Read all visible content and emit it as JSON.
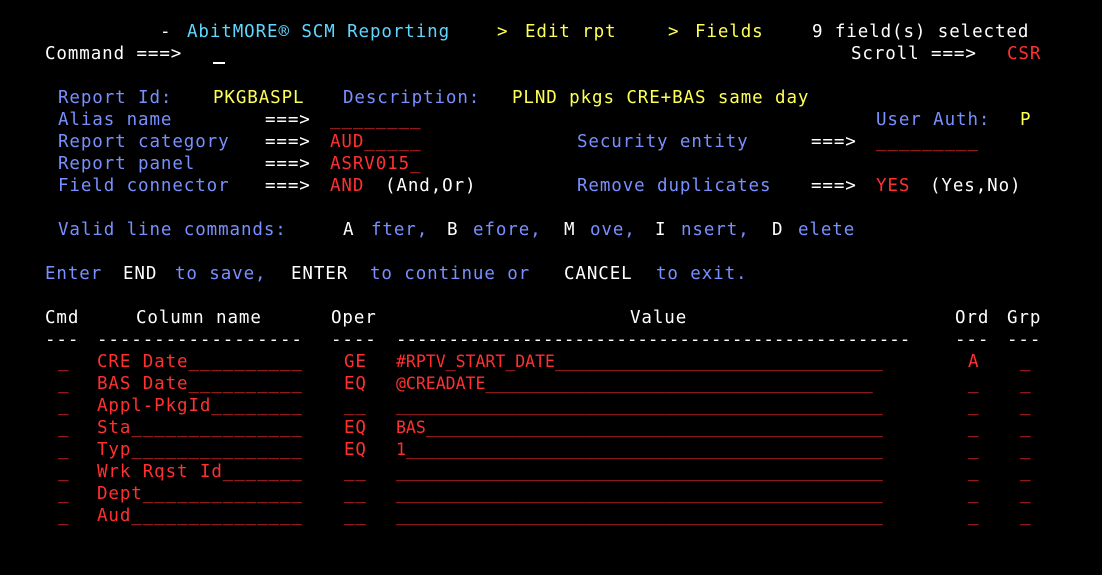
{
  "header": {
    "dash": "-",
    "product": "AbitMORE® SCM Reporting",
    "sep1": ">",
    "crumb1": "Edit rpt",
    "sep2": ">",
    "crumb2": "Fields",
    "status": "9 field(s) selected"
  },
  "command": {
    "label": "Command ===>",
    "value": "",
    "scroll_label": "Scroll ===>",
    "scroll_value": "CSR"
  },
  "report": {
    "id_label": "Report Id:",
    "id_value": "PKGBASPL",
    "desc_label": "Description:",
    "desc_value": "PLND pkgs CRE+BAS same day",
    "alias_label": "Alias name",
    "alias_arrow": "===>",
    "alias_value": "________",
    "user_auth_label": "User Auth:",
    "user_auth_value": "P",
    "category_label": "Report category",
    "category_arrow": "===>",
    "category_value": "AUD_____",
    "security_label": "Security entity",
    "security_arrow": "===>",
    "security_value": "_________",
    "panel_label": "Report panel",
    "panel_arrow": "===>",
    "panel_value": "ASRV015_",
    "connector_label": "Field connector",
    "connector_arrow": "===>",
    "connector_value": "AND",
    "connector_hint": "(And,Or)",
    "remove_dup_label": "Remove duplicates",
    "remove_dup_arrow": "===>",
    "remove_dup_value": "YES",
    "remove_dup_hint": "(Yes,No)"
  },
  "line_commands": {
    "label": "Valid line commands:",
    "a_key": "A",
    "a_text": "fter,",
    "b_key": "B",
    "b_text": "efore,",
    "m_key": "M",
    "m_text": "ove,",
    "i_key": "I",
    "i_text": "nsert,",
    "d_key": "D",
    "d_text": "elete"
  },
  "instructions": {
    "t1": "Enter",
    "k1": "END",
    "t2": "to save,",
    "k2": "ENTER",
    "t3": "to continue or",
    "k3": "CANCEL",
    "t4": "to exit."
  },
  "table": {
    "headers": {
      "cmd": "Cmd",
      "column": "Column name",
      "oper": "Oper",
      "value": "Value",
      "ord": "Ord",
      "grp": "Grp"
    },
    "dividers": {
      "cmd": "---",
      "column": "------------------",
      "oper": "----",
      "value": "-------------------------------------------------",
      "ord": "---",
      "grp": "---"
    },
    "rows": [
      {
        "cmd": "_",
        "column": "CRE Date__________",
        "oper": "GE",
        "value": "#RPTV_START_DATE_________________________________",
        "ord": "A",
        "grp": "_"
      },
      {
        "cmd": "_",
        "column": "BAS Date__________",
        "oper": "EQ",
        "value": "@CREADATE_______________________________________",
        "ord": "_",
        "grp": "_"
      },
      {
        "cmd": "_",
        "column": "Appl-PkgId________",
        "oper": "__",
        "value": "_________________________________________________",
        "ord": "_",
        "grp": "_"
      },
      {
        "cmd": "_",
        "column": "Sta_______________",
        "oper": "EQ",
        "value": "BAS______________________________________________",
        "ord": "_",
        "grp": "_"
      },
      {
        "cmd": "_",
        "column": "Typ_______________",
        "oper": "EQ",
        "value": "1________________________________________________",
        "ord": "_",
        "grp": "_"
      },
      {
        "cmd": "_",
        "column": "Wrk Rqst Id_______",
        "oper": "__",
        "value": "_________________________________________________",
        "ord": "_",
        "grp": "_"
      },
      {
        "cmd": "_",
        "column": "Dept______________",
        "oper": "__",
        "value": "_________________________________________________",
        "ord": "_",
        "grp": "_"
      },
      {
        "cmd": "_",
        "column": "Aud_______________",
        "oper": "__",
        "value": "_________________________________________________",
        "ord": "_",
        "grp": "_"
      }
    ]
  },
  "colors": {
    "background": "#000000",
    "label_blue": "#7890ff",
    "field_red": "#ff3030",
    "value_yellow": "#ffff55",
    "text_white": "#ffffff",
    "product_cyan": "#5fd7ff"
  }
}
